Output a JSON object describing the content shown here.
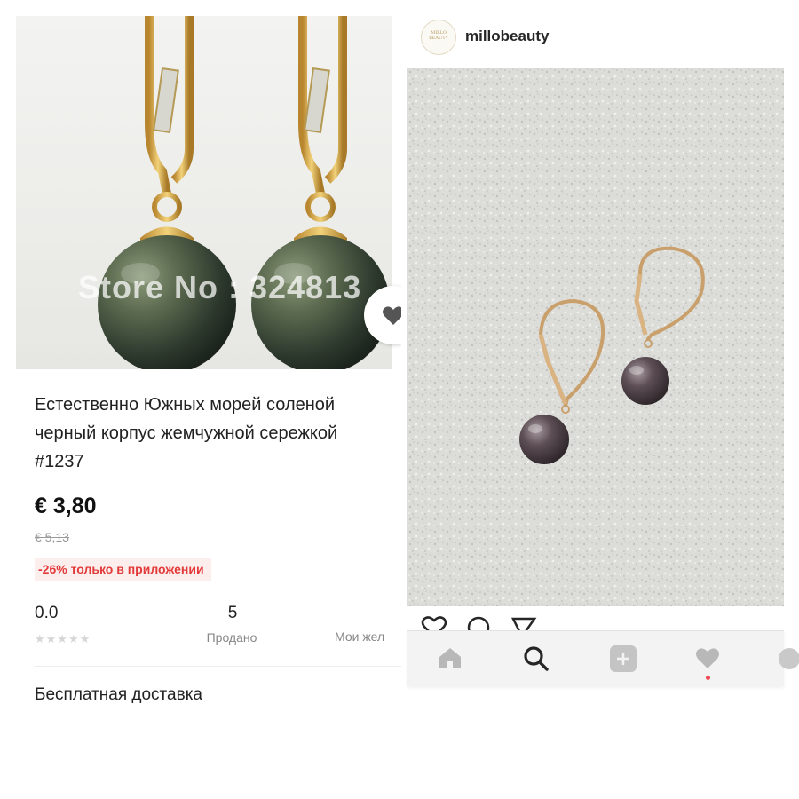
{
  "listing": {
    "watermark": "Store No : 324813",
    "title": "Естественно Южных морей соленой черный корпус жемчужной сережкой #1237",
    "price": "€ 3,80",
    "old_price": "€ 5,13",
    "discount": "-26% только в приложении",
    "rating_value": "0.0",
    "stars": "★★★★★",
    "sold_count": "5",
    "sold_label": "Продано",
    "wishlist_label": "Мои жел",
    "shipping": "Бесплатная доставка"
  },
  "instagram": {
    "avatar_text": "MILLO BEAUTY",
    "username": "millobeauty",
    "nav_items": [
      "home",
      "search",
      "add",
      "activity",
      "profile"
    ]
  },
  "colors": {
    "price_text": "#111111",
    "discount_text": "#e33a3a",
    "discount_bg": "#fdeeee",
    "nav_dot": "#ed4956"
  }
}
